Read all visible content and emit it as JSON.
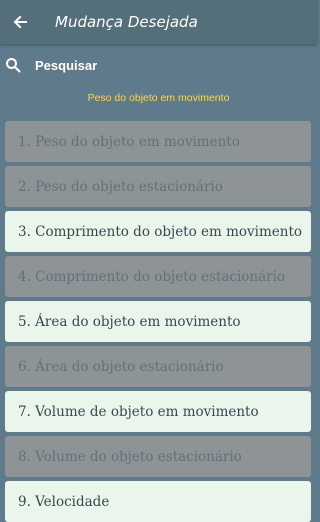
{
  "header": {
    "title": "Mudança Desejada",
    "back_icon": "arrow-left-icon"
  },
  "search": {
    "placeholder": "Pesquisar",
    "icon": "search-icon"
  },
  "section_label": "Peso do objeto em movimento",
  "colors": {
    "appbar": "#546e7a",
    "background": "#5f7b8b",
    "accent": "#ffd54f",
    "item_enabled_bg": "#eaf6ec",
    "item_disabled_bg": "#8e9496"
  },
  "items": [
    {
      "label": "1. Peso do objeto em movimento",
      "enabled": false
    },
    {
      "label": "2. Peso do objeto estacionário",
      "enabled": false
    },
    {
      "label": "3. Comprimento do objeto em movimento",
      "enabled": true
    },
    {
      "label": "4. Comprimento do objeto estacionário",
      "enabled": false
    },
    {
      "label": "5. Área do objeto em movimento",
      "enabled": true
    },
    {
      "label": "6. Área do objeto estacionário",
      "enabled": false
    },
    {
      "label": "7. Volume de objeto em movimento",
      "enabled": true
    },
    {
      "label": "8. Volume do objeto estacionário",
      "enabled": false
    },
    {
      "label": "9. Velocidade",
      "enabled": true
    }
  ]
}
